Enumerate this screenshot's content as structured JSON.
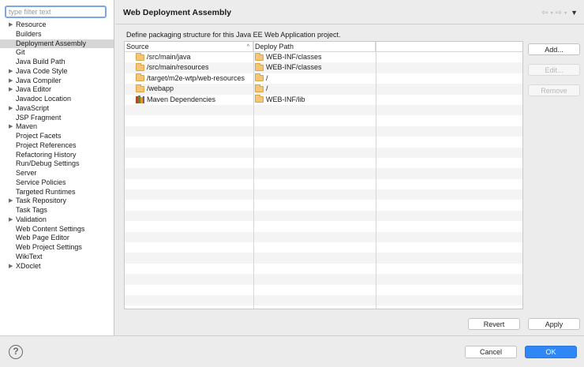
{
  "filter": {
    "placeholder": "type filter text",
    "value": ""
  },
  "tree": [
    {
      "label": "Resource",
      "expandable": true,
      "selected": false
    },
    {
      "label": "Builders",
      "expandable": false,
      "selected": false
    },
    {
      "label": "Deployment Assembly",
      "expandable": false,
      "selected": true
    },
    {
      "label": "Git",
      "expandable": false,
      "selected": false
    },
    {
      "label": "Java Build Path",
      "expandable": false,
      "selected": false
    },
    {
      "label": "Java Code Style",
      "expandable": true,
      "selected": false
    },
    {
      "label": "Java Compiler",
      "expandable": true,
      "selected": false
    },
    {
      "label": "Java Editor",
      "expandable": true,
      "selected": false
    },
    {
      "label": "Javadoc Location",
      "expandable": false,
      "selected": false
    },
    {
      "label": "JavaScript",
      "expandable": true,
      "selected": false
    },
    {
      "label": "JSP Fragment",
      "expandable": false,
      "selected": false
    },
    {
      "label": "Maven",
      "expandable": true,
      "selected": false
    },
    {
      "label": "Project Facets",
      "expandable": false,
      "selected": false
    },
    {
      "label": "Project References",
      "expandable": false,
      "selected": false
    },
    {
      "label": "Refactoring History",
      "expandable": false,
      "selected": false
    },
    {
      "label": "Run/Debug Settings",
      "expandable": false,
      "selected": false
    },
    {
      "label": "Server",
      "expandable": false,
      "selected": false
    },
    {
      "label": "Service Policies",
      "expandable": false,
      "selected": false
    },
    {
      "label": "Targeted Runtimes",
      "expandable": false,
      "selected": false
    },
    {
      "label": "Task Repository",
      "expandable": true,
      "selected": false
    },
    {
      "label": "Task Tags",
      "expandable": false,
      "selected": false
    },
    {
      "label": "Validation",
      "expandable": true,
      "selected": false
    },
    {
      "label": "Web Content Settings",
      "expandable": false,
      "selected": false
    },
    {
      "label": "Web Page Editor",
      "expandable": false,
      "selected": false
    },
    {
      "label": "Web Project Settings",
      "expandable": false,
      "selected": false
    },
    {
      "label": "WikiText",
      "expandable": false,
      "selected": false
    },
    {
      "label": "XDoclet",
      "expandable": true,
      "selected": false
    }
  ],
  "page": {
    "title": "Web Deployment Assembly",
    "description": "Define packaging structure for this Java EE Web Application project."
  },
  "nav_icons": {
    "back": "back-arrow-icon",
    "forward": "forward-arrow-icon",
    "menu": "view-menu-icon"
  },
  "table": {
    "columns": {
      "source": "Source",
      "deploy": "Deploy Path"
    },
    "rows": [
      {
        "source": "/src/main/java",
        "source_icon": "folder-icon",
        "deploy": "WEB-INF/classes"
      },
      {
        "source": "/src/main/resources",
        "source_icon": "folder-icon",
        "deploy": "WEB-INF/classes"
      },
      {
        "source": "/target/m2e-wtp/web-resources",
        "source_icon": "folder-icon",
        "deploy": "/"
      },
      {
        "source": "/webapp",
        "source_icon": "folder-icon",
        "deploy": "/"
      },
      {
        "source": "Maven Dependencies",
        "source_icon": "library-icon",
        "deploy": "WEB-INF/lib"
      }
    ],
    "empty_rows": 20
  },
  "buttons": {
    "add": "Add...",
    "edit": "Edit...",
    "remove": "Remove",
    "revert": "Revert",
    "apply": "Apply",
    "cancel": "Cancel",
    "ok": "OK"
  },
  "help": {
    "glyph": "?"
  },
  "colors": {
    "ok_button": "#2f86f5",
    "selected_row": "#d6d6d6",
    "filter_focus": "#7ba7e7",
    "folder": "#f4c676"
  }
}
